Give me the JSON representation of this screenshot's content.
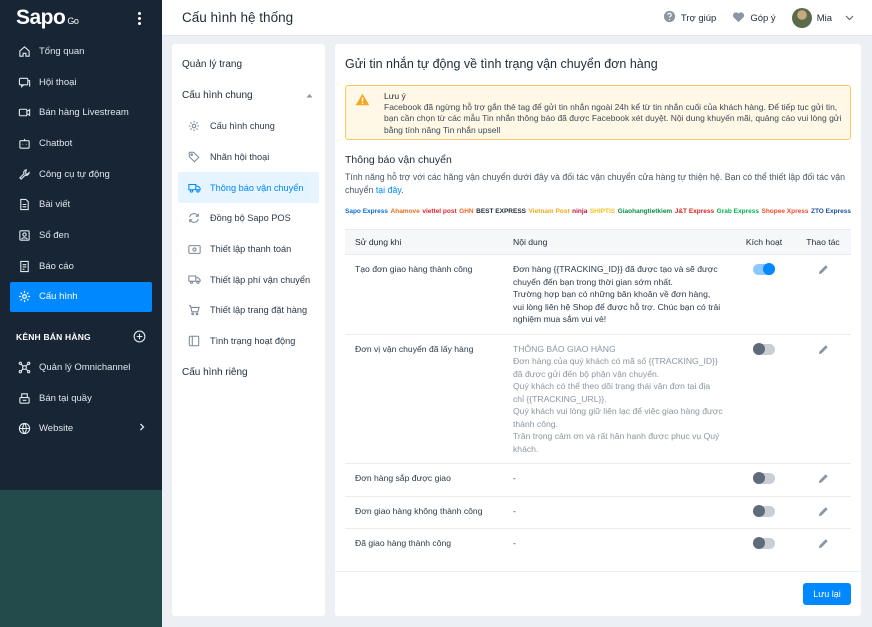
{
  "app": {
    "logo": "Sapo",
    "logo_suffix": "Go"
  },
  "sidebar": {
    "items": [
      {
        "label": "Tổng quan",
        "icon": "home-icon"
      },
      {
        "label": "Hội thoại",
        "icon": "chat-icon"
      },
      {
        "label": "Bán hàng Livestream",
        "icon": "video-icon"
      },
      {
        "label": "Chatbot",
        "icon": "bot-icon"
      },
      {
        "label": "Công cụ tự động",
        "icon": "wrench-icon"
      },
      {
        "label": "Bài viết",
        "icon": "document-icon"
      },
      {
        "label": "Sổ đen",
        "icon": "blacklist-icon"
      },
      {
        "label": "Báo cáo",
        "icon": "report-icon"
      },
      {
        "label": "Cấu hình",
        "icon": "gear-icon",
        "active": true
      }
    ],
    "channels_title": "KÊNH BÁN HÀNG",
    "channels": [
      {
        "label": "Quản lý Omnichannel",
        "icon": "omnichannel-icon"
      },
      {
        "label": "Bán tại quầy",
        "icon": "pos-icon"
      },
      {
        "label": "Website",
        "icon": "globe-icon"
      }
    ]
  },
  "header": {
    "title": "Cấu hình hệ thống",
    "help_label": "Trợ giúp",
    "feedback_label": "Góp ý",
    "user_name": "Mia"
  },
  "submenu": {
    "page_manage": "Quản lý trang",
    "general_title": "Cấu hình chung",
    "items": [
      {
        "label": "Cấu hình chung"
      },
      {
        "label": "Nhãn hội thoại"
      },
      {
        "label": "Thông báo vận chuyển",
        "active": true
      },
      {
        "label": "Đồng bộ Sapo POS"
      },
      {
        "label": "Thiết lập thanh toán"
      },
      {
        "label": "Thiết lập phí vận chuyển"
      },
      {
        "label": "Thiết lập trang đặt hàng"
      },
      {
        "label": "Tình trạng hoạt động"
      }
    ],
    "private_title": "Cấu hình riêng"
  },
  "main": {
    "title": "Gửi tin nhắn tự động về tình trạng vận chuyển đơn hàng",
    "alert_title": "Lưu ý",
    "alert_text": "Facebook đã ngừng hỗ trợ gắn thẻ tag để gửi tin nhắn ngoài 24h kể từ tin nhắn cuối của khách hàng.  Để tiếp tục gửi tin, bạn cần chọn từ các mẫu Tin nhắn thông báo đã được Facebook xét duyệt. Nội dung khuyến mãi, quảng cáo vui lòng gửi bằng tính năng Tin nhắn upsell",
    "ship_title": "Thông báo vận chuyển",
    "ship_desc": "Tính năng hỗ trợ với các hãng vận chuyển dưới đây và đối tác vận chuyển cửa hàng tự thiện hệ. Bạn có thể thiết lập đối tác vận chuyển ",
    "ship_link": "tại đây",
    "ship_desc_end": ".",
    "carriers": [
      {
        "name": "Sapo Express",
        "color": "#0a6fd6"
      },
      {
        "name": "Ahamove",
        "color": "#e9701c"
      },
      {
        "name": "viettel post",
        "color": "#e0242d"
      },
      {
        "name": "GHN",
        "color": "#f26522"
      },
      {
        "name": "BEST EXPRESS",
        "color": "#1f2a37"
      },
      {
        "name": "Vietnam Post",
        "color": "#f0a81c"
      },
      {
        "name": "ninja",
        "color": "#c2123c"
      },
      {
        "name": "SHIPTIS",
        "color": "#f4c21c"
      },
      {
        "name": "Giaohangtietkiem",
        "color": "#0a8a45"
      },
      {
        "name": "J&T Express",
        "color": "#d9201e"
      },
      {
        "name": "Grab Express",
        "color": "#00b14f"
      },
      {
        "name": "Shopee Xpress",
        "color": "#ee4d2d"
      },
      {
        "name": "ZTO Express",
        "color": "#1d4f9c"
      }
    ],
    "table": {
      "headers": [
        "Sử dụng khi",
        "Nội dung",
        "Kích hoạt",
        "Thao tác"
      ],
      "rows": [
        {
          "trigger": "Tạo đơn giao hàng thành công",
          "content": "Đơn hàng {{TRACKING_ID}} đã được tạo và sẽ được chuyển đến bạn trong thời gian sớm nhất.\nTrường hợp bạn có những băn khoăn về đơn hàng, vui lòng liên hệ Shop để được hỗ trợ. Chúc bạn có trải nghiệm mua sắm vui vẻ!",
          "muted": false,
          "active": true
        },
        {
          "trigger": "Đơn vị vận chuyển đã lấy hàng",
          "content": "THÔNG BÁO GIAO HÀNG\nĐơn hàng của quý khách có mã số {{TRACKING_ID}} đã được gửi đến bộ phận vận chuyển.\nQuý khách có thể theo dõi trạng thái vận đơn tại địa chỉ {{TRACKING_URL}}.\nQuý khách vui lòng giữ liên lạc để việc giao hàng được thành công.\nTrân trọng cảm ơn và rất hân hạnh được phục vụ Quý khách.",
          "muted": true,
          "active": false
        },
        {
          "trigger": "Đơn hàng sắp được giao",
          "content": "-",
          "muted": false,
          "active": false
        },
        {
          "trigger": "Đơn giao hàng không thành công",
          "content": "-",
          "muted": false,
          "active": false
        },
        {
          "trigger": "Đã giao hàng thành công",
          "content": "-",
          "muted": false,
          "active": false
        }
      ]
    },
    "save_label": "Lưu lại"
  },
  "colors": {
    "sidebar_bg": "#182535",
    "accent": "#0088ff",
    "alert_border": "#ffc65c",
    "alert_bg": "#fff8e6"
  }
}
